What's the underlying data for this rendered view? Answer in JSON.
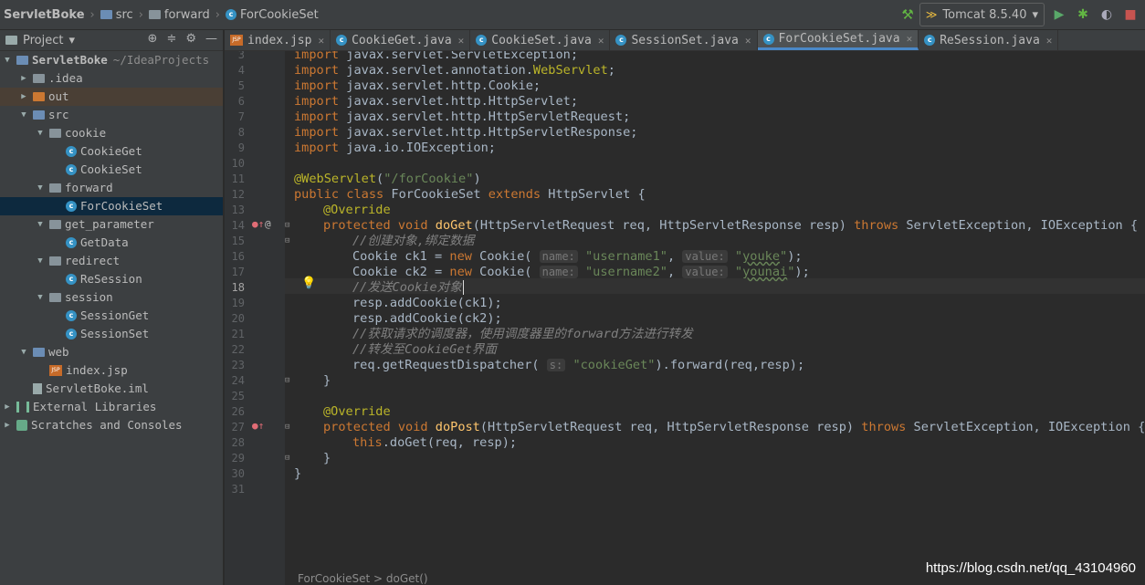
{
  "breadcrumb": [
    "ServletBoke",
    "src",
    "forward",
    "ForCookieSet"
  ],
  "run_config": {
    "label": "Tomcat 8.5.40"
  },
  "project_panel": {
    "title": "Project"
  },
  "tree": [
    {
      "label": "ServletBoke",
      "extra": "~/IdeaProjects",
      "indent": 0,
      "arrow": "▼",
      "icon": "folder-blue"
    },
    {
      "label": ".idea",
      "indent": 1,
      "arrow": "▶",
      "icon": "folder"
    },
    {
      "label": "out",
      "indent": 1,
      "arrow": "▶",
      "icon": "folder-orange"
    },
    {
      "label": "src",
      "indent": 1,
      "arrow": "▼",
      "icon": "folder-blue"
    },
    {
      "label": "cookie",
      "indent": 2,
      "arrow": "▼",
      "icon": "folder"
    },
    {
      "label": "CookieGet",
      "indent": 3,
      "arrow": "",
      "icon": "class"
    },
    {
      "label": "CookieSet",
      "indent": 3,
      "arrow": "",
      "icon": "class"
    },
    {
      "label": "forward",
      "indent": 2,
      "arrow": "▼",
      "icon": "folder"
    },
    {
      "label": "ForCookieSet",
      "indent": 3,
      "arrow": "",
      "icon": "class"
    },
    {
      "label": "get_parameter",
      "indent": 2,
      "arrow": "▼",
      "icon": "folder"
    },
    {
      "label": "GetData",
      "indent": 3,
      "arrow": "",
      "icon": "class"
    },
    {
      "label": "redirect",
      "indent": 2,
      "arrow": "▼",
      "icon": "folder"
    },
    {
      "label": "ReSession",
      "indent": 3,
      "arrow": "",
      "icon": "class"
    },
    {
      "label": "session",
      "indent": 2,
      "arrow": "▼",
      "icon": "folder"
    },
    {
      "label": "SessionGet",
      "indent": 3,
      "arrow": "",
      "icon": "class"
    },
    {
      "label": "SessionSet",
      "indent": 3,
      "arrow": "",
      "icon": "class"
    },
    {
      "label": "web",
      "indent": 1,
      "arrow": "▼",
      "icon": "folder-blue"
    },
    {
      "label": "index.jsp",
      "indent": 2,
      "arrow": "",
      "icon": "jsp"
    },
    {
      "label": "ServletBoke.iml",
      "indent": 1,
      "arrow": "",
      "icon": "iml"
    },
    {
      "label": "External Libraries",
      "indent": 0,
      "arrow": "▶",
      "icon": "lib"
    },
    {
      "label": "Scratches and Consoles",
      "indent": 0,
      "arrow": "▶",
      "icon": "scratch"
    }
  ],
  "tabs": [
    {
      "label": "index.jsp",
      "icon": "jsp"
    },
    {
      "label": "CookieGet.java",
      "icon": "class"
    },
    {
      "label": "CookieSet.java",
      "icon": "class"
    },
    {
      "label": "SessionSet.java",
      "icon": "class"
    },
    {
      "label": "ForCookieSet.java",
      "icon": "class"
    },
    {
      "label": "ReSession.java",
      "icon": "class"
    }
  ],
  "line_numbers": [
    "3",
    "4",
    "5",
    "6",
    "7",
    "8",
    "9",
    "10",
    "11",
    "12",
    "13",
    "14",
    "15",
    "16",
    "17",
    "18",
    "19",
    "20",
    "21",
    "22",
    "23",
    "24",
    "25",
    "26",
    "27",
    "28",
    "29",
    "30",
    "31"
  ],
  "code": {
    "l3_kw": "import",
    "l3_rest": " javax.servlet.ServletException;",
    "l4_kw": "import",
    "l4_pre": " javax.servlet.annotation.",
    "l4_ann": "WebServlet",
    "l4_end": ";",
    "l5_kw": "import",
    "l5_rest": " javax.servlet.http.Cookie;",
    "l6_kw": "import",
    "l6_rest": " javax.servlet.http.HttpServlet;",
    "l7_kw": "import",
    "l7_rest": " javax.servlet.http.HttpServletRequest;",
    "l8_kw": "import",
    "l8_rest": " javax.servlet.http.HttpServletResponse;",
    "l9_kw": "import",
    "l9_rest": " java.io.IOException;",
    "l11_ann": "@WebServlet",
    "l11_p1": "(",
    "l11_str": "\"/forCookie\"",
    "l11_p2": ")",
    "l12_kw1": "public class",
    "l12_name": " ForCookieSet ",
    "l12_kw2": "extends",
    "l12_rest": " HttpServlet {",
    "l13_ann": "@Override",
    "l14_kw": "protected void",
    "l14_m": "doGet",
    "l14_args": "(HttpServletRequest req, HttpServletResponse resp) ",
    "l14_kw2": "throws",
    "l14_rest": " ServletException, IOException {",
    "l15_cmt": "//创建对象,绑定数据",
    "l16_a": "Cookie ck1 = ",
    "l16_new": "new",
    "l16_b": " Cookie( ",
    "l16_h1": "name:",
    "l16_s1": "\"username1\"",
    "l16_c": ", ",
    "l16_h2": "value:",
    "l16_s2a": "\"",
    "l16_s2": "youke",
    "l16_s2b": "\"",
    "l16_end": ");",
    "l17_a": "Cookie ck2 = ",
    "l17_new": "new",
    "l17_b": " Cookie( ",
    "l17_h1": "name:",
    "l17_s1": "\"username2\"",
    "l17_c": ", ",
    "l17_h2": "value:",
    "l17_s2a": "\"",
    "l17_s2": "younai",
    "l17_s2b": "\"",
    "l17_end": ");",
    "l18_cmt": "//发送Cookie对象",
    "l19": "resp.addCookie(ck1);",
    "l20": "resp.addCookie(ck2);",
    "l21_cmt": "//获取请求的调度器，使用调度器里的forward方法进行转发",
    "l22_cmt": "//转发至CookieGet界面",
    "l23_a": "req.getRequestDispatcher( ",
    "l23_h": "s:",
    "l23_s": "\"cookieGet\"",
    "l23_b": ").forward(req,resp);",
    "l24": "}",
    "l26_ann": "@Override",
    "l27_kw": "protected void",
    "l27_m": "doPost",
    "l27_args": "(HttpServletRequest req, HttpServletResponse resp) ",
    "l27_kw2": "throws",
    "l27_rest": " ServletException, IOException {",
    "l28_kw": "this",
    "l28_rest": ".doGet(req, resp);",
    "l29": "}",
    "l30": "}"
  },
  "status_breadcrumb": "ForCookieSet > doGet()",
  "watermark": "https://blog.csdn.net/qq_43104960"
}
